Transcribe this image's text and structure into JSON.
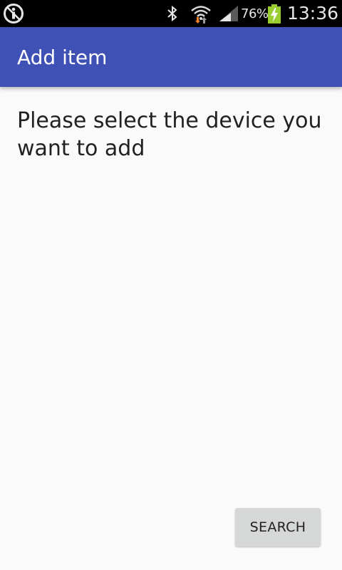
{
  "status_bar": {
    "battery_percent": "76%",
    "time": "13:36",
    "icons": [
      "info-icon",
      "bluetooth-icon",
      "wifi-icon",
      "signal-icon",
      "battery-charging-icon"
    ]
  },
  "app_bar": {
    "title": "Add item",
    "color": "#3f51b5"
  },
  "main": {
    "prompt": "Please select the device you want to add"
  },
  "actions": {
    "search_label": "SEARCH"
  }
}
